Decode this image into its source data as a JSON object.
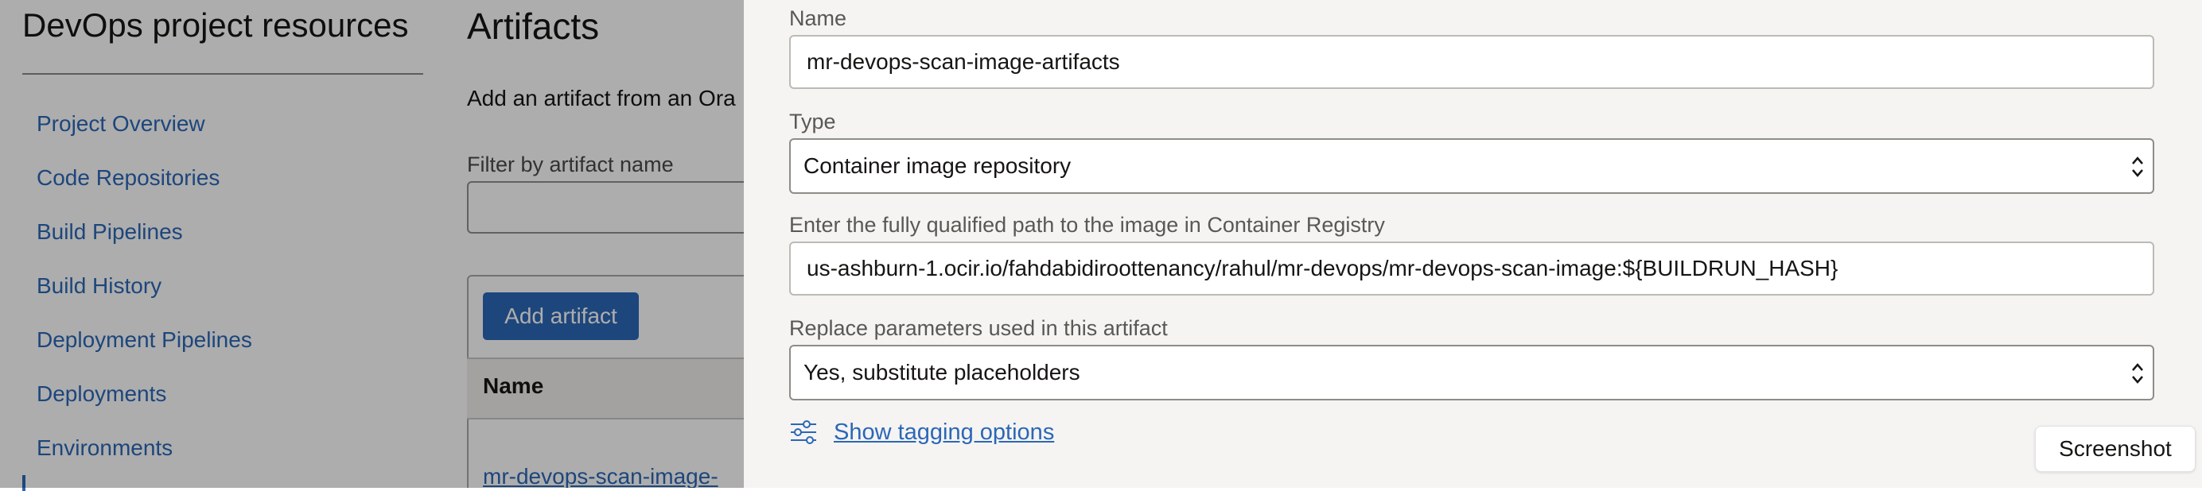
{
  "sidebar": {
    "title": "DevOps project resources",
    "items": [
      {
        "label": "Project Overview"
      },
      {
        "label": "Code Repositories"
      },
      {
        "label": "Build Pipelines"
      },
      {
        "label": "Build History"
      },
      {
        "label": "Deployment Pipelines"
      },
      {
        "label": "Deployments"
      },
      {
        "label": "Environments"
      }
    ]
  },
  "main": {
    "title": "Artifacts",
    "description": "Add an artifact from an Ora",
    "filter_label": "Filter by artifact name",
    "add_button": "Add artifact",
    "table": {
      "column_name": "Name",
      "rows": [
        {
          "name": "mr-devops-scan-image-"
        }
      ]
    }
  },
  "panel": {
    "name_label": "Name",
    "name_value": "mr-devops-scan-image-artifacts",
    "type_label": "Type",
    "type_value": "Container image repository",
    "path_label": "Enter the fully qualified path to the image in Container Registry",
    "path_value": "us-ashburn-1.ocir.io/fahdabidiroottenancy/rahul/mr-devops/mr-devops-scan-image:${BUILDRUN_HASH}",
    "replace_label": "Replace parameters used in this artifact",
    "replace_value": "Yes, substitute placeholders",
    "tagging_link": "Show tagging options",
    "icons": {
      "tagging": "sliders-icon",
      "select": "chevron-updown-icon"
    }
  },
  "screenshot_button": "Screenshot",
  "colors": {
    "link": "#2b67b7",
    "primary_button": "#2b67b7",
    "panel_bg": "#f5f4f2"
  }
}
